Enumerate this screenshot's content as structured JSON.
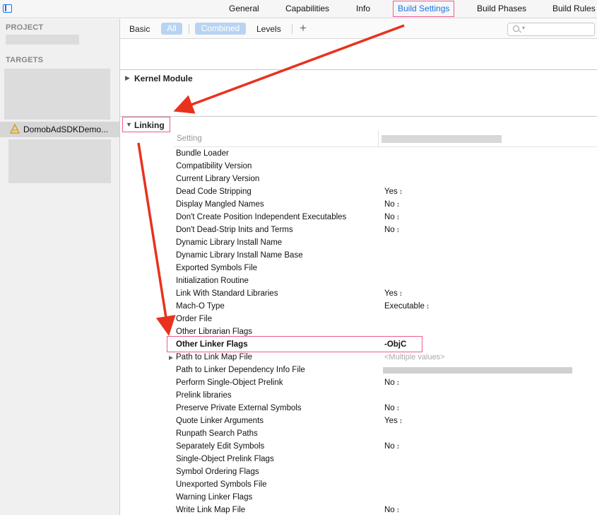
{
  "tabs": [
    {
      "label": "General"
    },
    {
      "label": "Capabilities"
    },
    {
      "label": "Info"
    },
    {
      "label": "Build Settings",
      "active": true
    },
    {
      "label": "Build Phases"
    },
    {
      "label": "Build Rules"
    }
  ],
  "sidebar": {
    "project_header": "PROJECT",
    "targets_header": "TARGETS",
    "selected_target": "DomobAdSDKDemo..."
  },
  "toolbar": {
    "basic": "Basic",
    "all": "All",
    "combined": "Combined",
    "levels": "Levels",
    "plus": "+",
    "search_placeholder": ""
  },
  "sections": {
    "kernel_module": "Kernel Module",
    "linking": "Linking"
  },
  "columns": {
    "setting": "Setting"
  },
  "settings": [
    {
      "name": "Bundle Loader",
      "value": ""
    },
    {
      "name": "Compatibility Version",
      "value": ""
    },
    {
      "name": "Current Library Version",
      "value": ""
    },
    {
      "name": "Dead Code Stripping",
      "value": "Yes",
      "stepper": true
    },
    {
      "name": "Display Mangled Names",
      "value": "No",
      "stepper": true
    },
    {
      "name": "Don't Create Position Independent Executables",
      "value": "No",
      "stepper": true
    },
    {
      "name": "Don't Dead-Strip Inits and Terms",
      "value": "No",
      "stepper": true
    },
    {
      "name": "Dynamic Library Install Name",
      "value": ""
    },
    {
      "name": "Dynamic Library Install Name Base",
      "value": ""
    },
    {
      "name": "Exported Symbols File",
      "value": ""
    },
    {
      "name": "Initialization Routine",
      "value": ""
    },
    {
      "name": "Link With Standard Libraries",
      "value": "Yes",
      "stepper": true
    },
    {
      "name": "Mach-O Type",
      "value": "Executable",
      "stepper": true
    },
    {
      "name": "Order File",
      "value": ""
    },
    {
      "name": "Other Librarian Flags",
      "value": ""
    },
    {
      "name": "Other Linker Flags",
      "value": "-ObjC",
      "bold": true
    },
    {
      "name": "Path to Link Map File",
      "value": "<Multiple values>",
      "placeholder": true,
      "disclosure": true
    },
    {
      "name": "Path to Linker Dependency Info File",
      "value": "",
      "blurred": true
    },
    {
      "name": "Perform Single-Object Prelink",
      "value": "No",
      "stepper": true
    },
    {
      "name": "Prelink libraries",
      "value": ""
    },
    {
      "name": "Preserve Private External Symbols",
      "value": "No",
      "stepper": true
    },
    {
      "name": "Quote Linker Arguments",
      "value": "Yes",
      "stepper": true
    },
    {
      "name": "Runpath Search Paths",
      "value": ""
    },
    {
      "name": "Separately Edit Symbols",
      "value": "No",
      "stepper": true
    },
    {
      "name": "Single-Object Prelink Flags",
      "value": ""
    },
    {
      "name": "Symbol Ordering Flags",
      "value": ""
    },
    {
      "name": "Unexported Symbols File",
      "value": ""
    },
    {
      "name": "Warning Linker Flags",
      "value": ""
    },
    {
      "name": "Write Link Map File",
      "value": "No",
      "stepper": true
    }
  ],
  "colors": {
    "accent": "#1a73e8",
    "annotation_box": "#ee5b94",
    "annotation_arrow": "#e8321e"
  }
}
